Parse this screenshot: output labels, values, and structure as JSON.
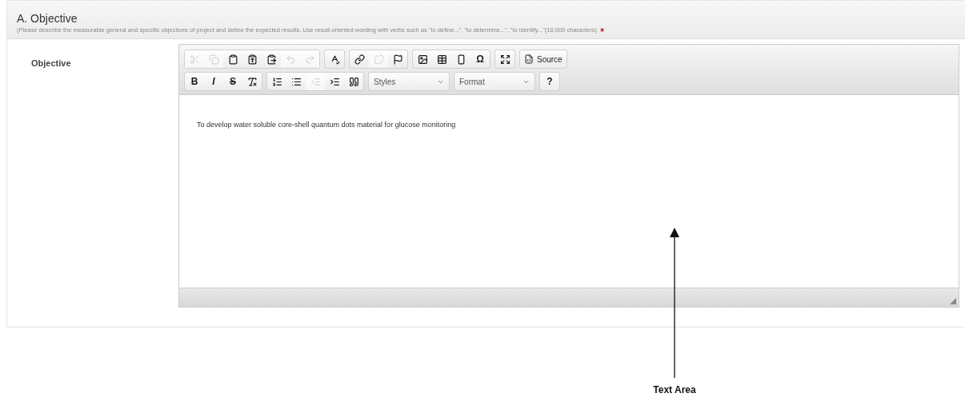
{
  "section": {
    "title": "A. Objective",
    "instructions": "(Please describe the measurable general and specific objectives of project and define the expected results. Use result-oriented wording with verbs such as \"to define...\", \"to determine...\", \"to identify...\"(10,000 characters)",
    "required_mark": "★"
  },
  "field": {
    "label": "Objective"
  },
  "editor": {
    "toolbar_rows": [
      [
        [
          {
            "kind": "icon",
            "disabled": true
          },
          {
            "kind": "icon",
            "disabled": true
          },
          {
            "kind": "icon",
            "disabled": false
          },
          {
            "kind": "icon",
            "disabled": false
          },
          {
            "kind": "icon",
            "disabled": false
          },
          {
            "kind": "icon",
            "disabled": true
          },
          {
            "kind": "icon",
            "disabled": true
          }
        ],
        [
          {
            "kind": "icon",
            "disabled": false
          }
        ],
        [
          {
            "kind": "icon",
            "disabled": false
          },
          {
            "kind": "icon",
            "disabled": true
          },
          {
            "kind": "icon",
            "disabled": false
          }
        ],
        [
          {
            "kind": "icon",
            "disabled": false
          },
          {
            "kind": "icon",
            "disabled": false
          },
          {
            "kind": "icon",
            "disabled": false
          },
          {
            "kind": "glyph",
            "label": "Ω",
            "disabled": false
          }
        ],
        [
          {
            "kind": "icon",
            "disabled": false
          }
        ],
        [
          {
            "kind": "source",
            "label": "Source",
            "disabled": false
          }
        ]
      ],
      [
        [
          {
            "kind": "glyph",
            "label": "B",
            "disabled": false
          },
          {
            "kind": "glyph",
            "label": "I",
            "disabled": false
          },
          {
            "kind": "glyph",
            "label": "S",
            "disabled": false
          },
          {
            "kind": "icon",
            "disabled": false
          }
        ],
        [
          {
            "kind": "icon",
            "disabled": false
          },
          {
            "kind": "icon",
            "disabled": false
          },
          {
            "kind": "icon",
            "disabled": true
          },
          {
            "kind": "icon",
            "disabled": false
          },
          {
            "kind": "icon",
            "disabled": false
          }
        ],
        [
          {
            "kind": "dropdown",
            "label": "Styles",
            "disabled": false
          }
        ],
        [
          {
            "kind": "dropdown",
            "label": "Format",
            "disabled": false
          }
        ],
        [
          {
            "kind": "glyph",
            "label": "?",
            "disabled": false
          }
        ]
      ]
    ],
    "content": "To develop water soluble core-shell quantum dots material for glucose monitoring"
  },
  "annotation": {
    "label": "Text Area"
  }
}
